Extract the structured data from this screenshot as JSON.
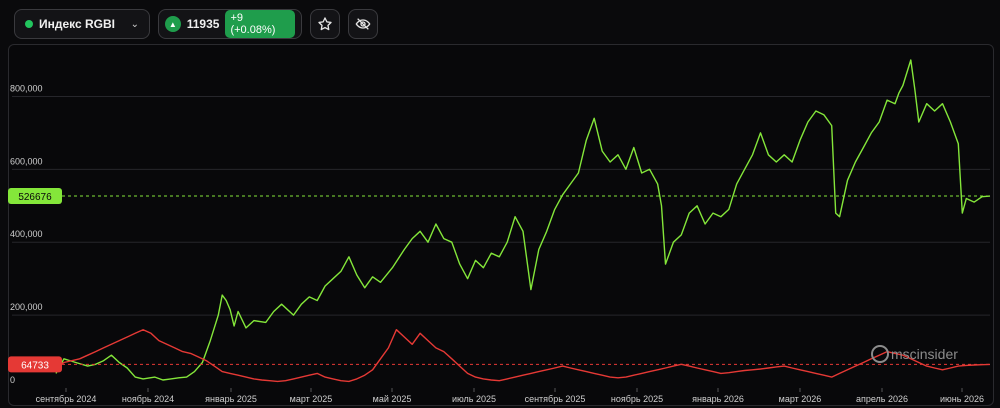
{
  "toolbar": {
    "index_name": "Индекс RGBI",
    "index_value": "11935",
    "change": "+9 (+0.08%)",
    "favorite_icon": "star-icon",
    "hide_icon": "eye-off-icon",
    "dropdown_icon": "chevron-down-icon",
    "status_color": "#22c55e"
  },
  "watermark": {
    "text": "mscinsider"
  },
  "chart_data": {
    "type": "line",
    "y_ticks": [
      "800,000",
      "600,000",
      "400,000",
      "200,000",
      "0"
    ],
    "ylim": [
      0,
      900000
    ],
    "x_ticks": [
      "сентябрь 2024",
      "ноябрь 2024",
      "январь 2025",
      "март 2025",
      "май 2025",
      "июль 2025",
      "сентябрь 2025",
      "ноябрь 2025",
      "январь 2026",
      "март 2026",
      "апрель 2026",
      "июнь 2026"
    ],
    "grid": true,
    "series": [
      {
        "color": "#84e63a",
        "last_label": "526676",
        "last_value": 526676,
        "points": [
          [
            0,
            40000
          ],
          [
            0.02,
            80000
          ],
          [
            0.05,
            70000
          ],
          [
            0.08,
            60000
          ],
          [
            0.1,
            65000
          ],
          [
            0.12,
            75000
          ],
          [
            0.14,
            90000
          ],
          [
            0.16,
            70000
          ],
          [
            0.18,
            55000
          ],
          [
            0.2,
            30000
          ],
          [
            0.22,
            25000
          ],
          [
            0.25,
            30000
          ],
          [
            0.27,
            22000
          ],
          [
            0.29,
            25000
          ],
          [
            0.31,
            28000
          ],
          [
            0.33,
            30000
          ],
          [
            0.35,
            45000
          ],
          [
            0.37,
            70000
          ],
          [
            0.39,
            130000
          ],
          [
            0.41,
            200000
          ],
          [
            0.42,
            255000
          ],
          [
            0.43,
            240000
          ],
          [
            0.44,
            215000
          ],
          [
            0.45,
            170000
          ],
          [
            0.46,
            210000
          ],
          [
            0.48,
            165000
          ],
          [
            0.5,
            185000
          ],
          [
            0.53,
            180000
          ],
          [
            0.55,
            210000
          ],
          [
            0.57,
            230000
          ],
          [
            0.6,
            200000
          ],
          [
            0.62,
            230000
          ],
          [
            0.64,
            250000
          ],
          [
            0.66,
            240000
          ],
          [
            0.68,
            280000
          ],
          [
            0.7,
            300000
          ],
          [
            0.72,
            320000
          ],
          [
            0.74,
            360000
          ],
          [
            0.76,
            310000
          ],
          [
            0.78,
            275000
          ],
          [
            0.8,
            305000
          ],
          [
            0.82,
            290000
          ],
          [
            0.85,
            330000
          ],
          [
            0.88,
            380000
          ],
          [
            0.9,
            410000
          ],
          [
            0.92,
            430000
          ],
          [
            0.94,
            400000
          ],
          [
            0.96,
            450000
          ],
          [
            0.98,
            410000
          ],
          [
            1.0,
            400000
          ],
          [
            1.02,
            340000
          ],
          [
            1.04,
            300000
          ],
          [
            1.06,
            350000
          ],
          [
            1.08,
            330000
          ],
          [
            1.1,
            370000
          ],
          [
            1.12,
            360000
          ],
          [
            1.14,
            400000
          ],
          [
            1.16,
            470000
          ],
          [
            1.18,
            430000
          ],
          [
            1.2,
            270000
          ],
          [
            1.22,
            380000
          ],
          [
            1.24,
            430000
          ],
          [
            1.26,
            490000
          ],
          [
            1.28,
            530000
          ],
          [
            1.3,
            560000
          ],
          [
            1.32,
            590000
          ],
          [
            1.34,
            680000
          ],
          [
            1.36,
            740000
          ],
          [
            1.38,
            650000
          ],
          [
            1.4,
            620000
          ],
          [
            1.42,
            640000
          ],
          [
            1.44,
            600000
          ],
          [
            1.46,
            660000
          ],
          [
            1.48,
            590000
          ],
          [
            1.5,
            600000
          ],
          [
            1.52,
            560000
          ],
          [
            1.53,
            500000
          ],
          [
            1.54,
            340000
          ],
          [
            1.56,
            400000
          ],
          [
            1.58,
            420000
          ],
          [
            1.6,
            480000
          ],
          [
            1.62,
            500000
          ],
          [
            1.64,
            450000
          ],
          [
            1.66,
            480000
          ],
          [
            1.68,
            470000
          ],
          [
            1.7,
            490000
          ],
          [
            1.72,
            560000
          ],
          [
            1.74,
            600000
          ],
          [
            1.76,
            640000
          ],
          [
            1.78,
            700000
          ],
          [
            1.8,
            640000
          ],
          [
            1.82,
            620000
          ],
          [
            1.84,
            640000
          ],
          [
            1.86,
            620000
          ],
          [
            1.88,
            680000
          ],
          [
            1.9,
            730000
          ],
          [
            1.92,
            760000
          ],
          [
            1.94,
            750000
          ],
          [
            1.96,
            720000
          ],
          [
            1.97,
            480000
          ],
          [
            1.98,
            470000
          ],
          [
            2.0,
            570000
          ],
          [
            2.02,
            620000
          ],
          [
            2.04,
            660000
          ],
          [
            2.06,
            700000
          ],
          [
            2.08,
            730000
          ],
          [
            2.1,
            790000
          ],
          [
            2.12,
            780000
          ],
          [
            2.13,
            810000
          ],
          [
            2.14,
            830000
          ],
          [
            2.16,
            900000
          ],
          [
            2.17,
            820000
          ],
          [
            2.18,
            730000
          ],
          [
            2.2,
            780000
          ],
          [
            2.22,
            760000
          ],
          [
            2.24,
            780000
          ],
          [
            2.26,
            730000
          ],
          [
            2.28,
            670000
          ],
          [
            2.29,
            480000
          ],
          [
            2.3,
            520000
          ],
          [
            2.32,
            510000
          ],
          [
            2.34,
            525000
          ],
          [
            2.36,
            526676
          ]
        ]
      },
      {
        "color": "#e53935",
        "last_label": "64733",
        "last_value": 64733,
        "points": [
          [
            0,
            55000
          ],
          [
            0.02,
            70000
          ],
          [
            0.04,
            75000
          ],
          [
            0.06,
            80000
          ],
          [
            0.08,
            90000
          ],
          [
            0.1,
            100000
          ],
          [
            0.12,
            110000
          ],
          [
            0.14,
            120000
          ],
          [
            0.16,
            130000
          ],
          [
            0.18,
            140000
          ],
          [
            0.2,
            150000
          ],
          [
            0.22,
            160000
          ],
          [
            0.24,
            150000
          ],
          [
            0.26,
            130000
          ],
          [
            0.28,
            120000
          ],
          [
            0.3,
            110000
          ],
          [
            0.32,
            100000
          ],
          [
            0.34,
            95000
          ],
          [
            0.36,
            85000
          ],
          [
            0.38,
            75000
          ],
          [
            0.4,
            60000
          ],
          [
            0.42,
            45000
          ],
          [
            0.44,
            40000
          ],
          [
            0.46,
            35000
          ],
          [
            0.48,
            30000
          ],
          [
            0.5,
            25000
          ],
          [
            0.52,
            22000
          ],
          [
            0.54,
            20000
          ],
          [
            0.56,
            18000
          ],
          [
            0.58,
            20000
          ],
          [
            0.6,
            25000
          ],
          [
            0.62,
            30000
          ],
          [
            0.64,
            35000
          ],
          [
            0.66,
            40000
          ],
          [
            0.68,
            30000
          ],
          [
            0.7,
            25000
          ],
          [
            0.72,
            20000
          ],
          [
            0.74,
            18000
          ],
          [
            0.76,
            25000
          ],
          [
            0.78,
            35000
          ],
          [
            0.8,
            50000
          ],
          [
            0.82,
            80000
          ],
          [
            0.84,
            110000
          ],
          [
            0.86,
            160000
          ],
          [
            0.88,
            140000
          ],
          [
            0.9,
            120000
          ],
          [
            0.92,
            150000
          ],
          [
            0.94,
            130000
          ],
          [
            0.96,
            110000
          ],
          [
            0.98,
            100000
          ],
          [
            1.0,
            80000
          ],
          [
            1.02,
            60000
          ],
          [
            1.04,
            40000
          ],
          [
            1.06,
            30000
          ],
          [
            1.08,
            25000
          ],
          [
            1.1,
            22000
          ],
          [
            1.12,
            20000
          ],
          [
            1.14,
            25000
          ],
          [
            1.16,
            30000
          ],
          [
            1.18,
            35000
          ],
          [
            1.2,
            40000
          ],
          [
            1.22,
            45000
          ],
          [
            1.24,
            50000
          ],
          [
            1.26,
            55000
          ],
          [
            1.28,
            60000
          ],
          [
            1.3,
            55000
          ],
          [
            1.32,
            50000
          ],
          [
            1.34,
            45000
          ],
          [
            1.36,
            40000
          ],
          [
            1.38,
            35000
          ],
          [
            1.4,
            30000
          ],
          [
            1.42,
            28000
          ],
          [
            1.44,
            30000
          ],
          [
            1.46,
            35000
          ],
          [
            1.48,
            40000
          ],
          [
            1.5,
            45000
          ],
          [
            1.52,
            50000
          ],
          [
            1.54,
            55000
          ],
          [
            1.56,
            60000
          ],
          [
            1.58,
            65000
          ],
          [
            1.6,
            60000
          ],
          [
            1.62,
            55000
          ],
          [
            1.64,
            50000
          ],
          [
            1.66,
            45000
          ],
          [
            1.68,
            40000
          ],
          [
            1.7,
            42000
          ],
          [
            1.72,
            45000
          ],
          [
            1.74,
            48000
          ],
          [
            1.76,
            50000
          ],
          [
            1.78,
            52000
          ],
          [
            1.8,
            55000
          ],
          [
            1.82,
            58000
          ],
          [
            1.84,
            60000
          ],
          [
            1.86,
            55000
          ],
          [
            1.88,
            50000
          ],
          [
            1.9,
            45000
          ],
          [
            1.92,
            40000
          ],
          [
            1.94,
            35000
          ],
          [
            1.96,
            30000
          ],
          [
            1.98,
            40000
          ],
          [
            2.0,
            50000
          ],
          [
            2.02,
            60000
          ],
          [
            2.04,
            70000
          ],
          [
            2.06,
            80000
          ],
          [
            2.08,
            90000
          ],
          [
            2.1,
            100000
          ],
          [
            2.12,
            95000
          ],
          [
            2.14,
            90000
          ],
          [
            2.16,
            80000
          ],
          [
            2.18,
            70000
          ],
          [
            2.2,
            60000
          ],
          [
            2.22,
            55000
          ],
          [
            2.24,
            50000
          ],
          [
            2.26,
            55000
          ],
          [
            2.28,
            60000
          ],
          [
            2.3,
            62000
          ],
          [
            2.32,
            63000
          ],
          [
            2.34,
            64000
          ],
          [
            2.36,
            64733
          ]
        ]
      }
    ]
  }
}
